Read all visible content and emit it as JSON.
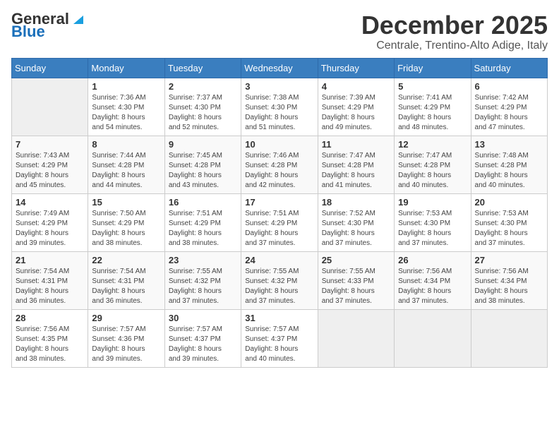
{
  "logo": {
    "line1": "General",
    "line2": "Blue"
  },
  "title": "December 2025",
  "location": "Centrale, Trentino-Alto Adige, Italy",
  "weekdays": [
    "Sunday",
    "Monday",
    "Tuesday",
    "Wednesday",
    "Thursday",
    "Friday",
    "Saturday"
  ],
  "weeks": [
    [
      {
        "day": "",
        "info": ""
      },
      {
        "day": "1",
        "info": "Sunrise: 7:36 AM\nSunset: 4:30 PM\nDaylight: 8 hours\nand 54 minutes."
      },
      {
        "day": "2",
        "info": "Sunrise: 7:37 AM\nSunset: 4:30 PM\nDaylight: 8 hours\nand 52 minutes."
      },
      {
        "day": "3",
        "info": "Sunrise: 7:38 AM\nSunset: 4:30 PM\nDaylight: 8 hours\nand 51 minutes."
      },
      {
        "day": "4",
        "info": "Sunrise: 7:39 AM\nSunset: 4:29 PM\nDaylight: 8 hours\nand 49 minutes."
      },
      {
        "day": "5",
        "info": "Sunrise: 7:41 AM\nSunset: 4:29 PM\nDaylight: 8 hours\nand 48 minutes."
      },
      {
        "day": "6",
        "info": "Sunrise: 7:42 AM\nSunset: 4:29 PM\nDaylight: 8 hours\nand 47 minutes."
      }
    ],
    [
      {
        "day": "7",
        "info": "Sunrise: 7:43 AM\nSunset: 4:29 PM\nDaylight: 8 hours\nand 45 minutes."
      },
      {
        "day": "8",
        "info": "Sunrise: 7:44 AM\nSunset: 4:28 PM\nDaylight: 8 hours\nand 44 minutes."
      },
      {
        "day": "9",
        "info": "Sunrise: 7:45 AM\nSunset: 4:28 PM\nDaylight: 8 hours\nand 43 minutes."
      },
      {
        "day": "10",
        "info": "Sunrise: 7:46 AM\nSunset: 4:28 PM\nDaylight: 8 hours\nand 42 minutes."
      },
      {
        "day": "11",
        "info": "Sunrise: 7:47 AM\nSunset: 4:28 PM\nDaylight: 8 hours\nand 41 minutes."
      },
      {
        "day": "12",
        "info": "Sunrise: 7:47 AM\nSunset: 4:28 PM\nDaylight: 8 hours\nand 40 minutes."
      },
      {
        "day": "13",
        "info": "Sunrise: 7:48 AM\nSunset: 4:28 PM\nDaylight: 8 hours\nand 40 minutes."
      }
    ],
    [
      {
        "day": "14",
        "info": "Sunrise: 7:49 AM\nSunset: 4:29 PM\nDaylight: 8 hours\nand 39 minutes."
      },
      {
        "day": "15",
        "info": "Sunrise: 7:50 AM\nSunset: 4:29 PM\nDaylight: 8 hours\nand 38 minutes."
      },
      {
        "day": "16",
        "info": "Sunrise: 7:51 AM\nSunset: 4:29 PM\nDaylight: 8 hours\nand 38 minutes."
      },
      {
        "day": "17",
        "info": "Sunrise: 7:51 AM\nSunset: 4:29 PM\nDaylight: 8 hours\nand 37 minutes."
      },
      {
        "day": "18",
        "info": "Sunrise: 7:52 AM\nSunset: 4:30 PM\nDaylight: 8 hours\nand 37 minutes."
      },
      {
        "day": "19",
        "info": "Sunrise: 7:53 AM\nSunset: 4:30 PM\nDaylight: 8 hours\nand 37 minutes."
      },
      {
        "day": "20",
        "info": "Sunrise: 7:53 AM\nSunset: 4:30 PM\nDaylight: 8 hours\nand 37 minutes."
      }
    ],
    [
      {
        "day": "21",
        "info": "Sunrise: 7:54 AM\nSunset: 4:31 PM\nDaylight: 8 hours\nand 36 minutes."
      },
      {
        "day": "22",
        "info": "Sunrise: 7:54 AM\nSunset: 4:31 PM\nDaylight: 8 hours\nand 36 minutes."
      },
      {
        "day": "23",
        "info": "Sunrise: 7:55 AM\nSunset: 4:32 PM\nDaylight: 8 hours\nand 37 minutes."
      },
      {
        "day": "24",
        "info": "Sunrise: 7:55 AM\nSunset: 4:32 PM\nDaylight: 8 hours\nand 37 minutes."
      },
      {
        "day": "25",
        "info": "Sunrise: 7:55 AM\nSunset: 4:33 PM\nDaylight: 8 hours\nand 37 minutes."
      },
      {
        "day": "26",
        "info": "Sunrise: 7:56 AM\nSunset: 4:34 PM\nDaylight: 8 hours\nand 37 minutes."
      },
      {
        "day": "27",
        "info": "Sunrise: 7:56 AM\nSunset: 4:34 PM\nDaylight: 8 hours\nand 38 minutes."
      }
    ],
    [
      {
        "day": "28",
        "info": "Sunrise: 7:56 AM\nSunset: 4:35 PM\nDaylight: 8 hours\nand 38 minutes."
      },
      {
        "day": "29",
        "info": "Sunrise: 7:57 AM\nSunset: 4:36 PM\nDaylight: 8 hours\nand 39 minutes."
      },
      {
        "day": "30",
        "info": "Sunrise: 7:57 AM\nSunset: 4:37 PM\nDaylight: 8 hours\nand 39 minutes."
      },
      {
        "day": "31",
        "info": "Sunrise: 7:57 AM\nSunset: 4:37 PM\nDaylight: 8 hours\nand 40 minutes."
      },
      {
        "day": "",
        "info": ""
      },
      {
        "day": "",
        "info": ""
      },
      {
        "day": "",
        "info": ""
      }
    ]
  ]
}
